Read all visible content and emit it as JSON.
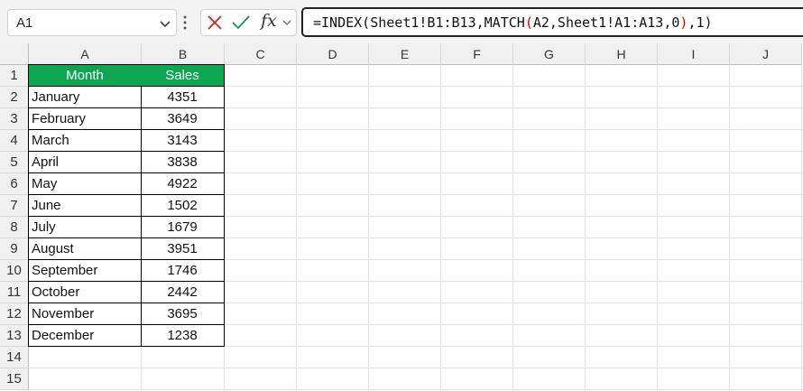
{
  "formula_bar": {
    "name_box": "A1",
    "fx_label": "fx",
    "formula_parts": [
      {
        "text": "=INDEX(Sheet1!B1:B13,MATCH",
        "color": "#111111"
      },
      {
        "text": "(",
        "color": "#c00000"
      },
      {
        "text": "A2,Sheet1!A1:A13,0",
        "color": "#111111"
      },
      {
        "text": ")",
        "color": "#c00000"
      },
      {
        "text": ",1)",
        "color": "#111111"
      }
    ],
    "icons": {
      "cancel": "x-icon",
      "enter": "checkmark-icon",
      "more": "vertical-ellipsis-icon",
      "dropdown": "chevron-down-icon"
    }
  },
  "columns": [
    "A",
    "B",
    "C",
    "D",
    "E",
    "F",
    "G",
    "H",
    "I",
    "J"
  ],
  "rows": [
    "1",
    "2",
    "3",
    "4",
    "5",
    "6",
    "7",
    "8",
    "9",
    "10",
    "11",
    "12",
    "13",
    "14",
    "15"
  ],
  "table": {
    "header_color": "#0ca650",
    "headers": [
      "Month",
      "Sales"
    ],
    "rows": [
      [
        "January",
        "4351"
      ],
      [
        "February",
        "3649"
      ],
      [
        "March",
        "3143"
      ],
      [
        "April",
        "3838"
      ],
      [
        "May",
        "4922"
      ],
      [
        "June",
        "1502"
      ],
      [
        "July",
        "1679"
      ],
      [
        "August",
        "3951"
      ],
      [
        "September",
        "1746"
      ],
      [
        "October",
        "2442"
      ],
      [
        "November",
        "3695"
      ],
      [
        "December",
        "1238"
      ]
    ]
  }
}
